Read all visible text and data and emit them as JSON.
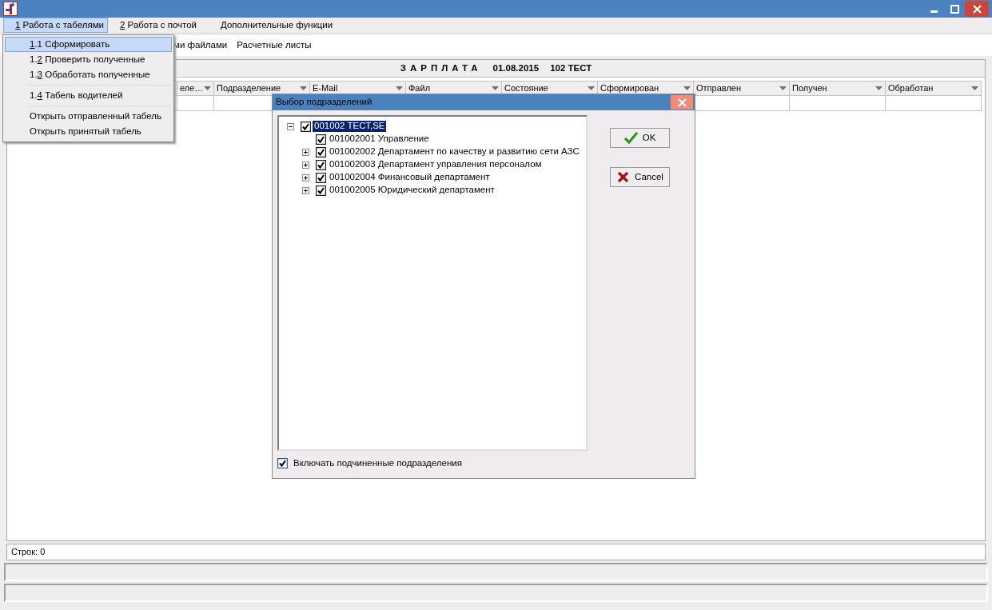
{
  "menu_bar": [
    {
      "key": "1",
      "label": " Работа с табелями",
      "selected": true
    },
    {
      "key": "2",
      "label": " Работа с почтой",
      "selected": false
    },
    {
      "label": "Дополнительные функции",
      "selected": false
    }
  ],
  "dropdown": [
    {
      "kind": "item",
      "key": "1",
      "after": ".1 Сформировать",
      "selected": true
    },
    {
      "kind": "item",
      "before": "1.",
      "key": "2",
      "after": " Проверить полученные",
      "selected": false
    },
    {
      "kind": "item",
      "before": "1.",
      "key": "3",
      "after": " Обработать полученные",
      "selected": false
    },
    {
      "kind": "separator"
    },
    {
      "kind": "item",
      "before": "1.",
      "key": "4",
      "after": " Табель водителей",
      "selected": false
    },
    {
      "kind": "separator"
    },
    {
      "kind": "item",
      "label": "Открыть отправленный табель",
      "selected": false
    },
    {
      "kind": "item",
      "label": "Открыть принятый табель",
      "selected": false
    }
  ],
  "toolbar": [
    "ми файлами",
    "Расчетные листы"
  ],
  "report_title": {
    "name": "ЗАРПЛАТА",
    "date": "01.08.2015",
    "code": "102 ТЕСТ"
  },
  "table": {
    "columns": [
      "еле…",
      "Подразделение",
      "E-Mail",
      "Файл",
      "Состояние",
      "Сформирован",
      "Отправлен",
      "Получен",
      "Обработан"
    ]
  },
  "row_count": "Строк: 0",
  "dialog": {
    "title": "Выбор подразделений",
    "tree": [
      {
        "label": "001002 ТЕСТ,SE",
        "checked": true,
        "selected": true,
        "expanded": true,
        "children": [
          {
            "label": "001002001 Управление",
            "checked": true,
            "selected": false
          },
          {
            "label": "001002002 Департамент по качеству и развитию сети АЗС",
            "checked": true,
            "selected": false,
            "expanded": false
          },
          {
            "label": "001002003 Департамент управления персоналом",
            "checked": true,
            "selected": false,
            "expanded": false
          },
          {
            "label": "001002004 Финансовый департамент",
            "checked": true,
            "selected": false,
            "expanded": false
          },
          {
            "label": "001002005 Юридический департамент",
            "checked": true,
            "selected": false,
            "expanded": false
          }
        ]
      }
    ],
    "buttons": [
      {
        "kind": "ok",
        "label": "OK"
      },
      {
        "kind": "cancel",
        "label": "Cancel"
      }
    ],
    "include_sub": {
      "label": "Включать подчиненные подразделения",
      "checked": true
    }
  }
}
